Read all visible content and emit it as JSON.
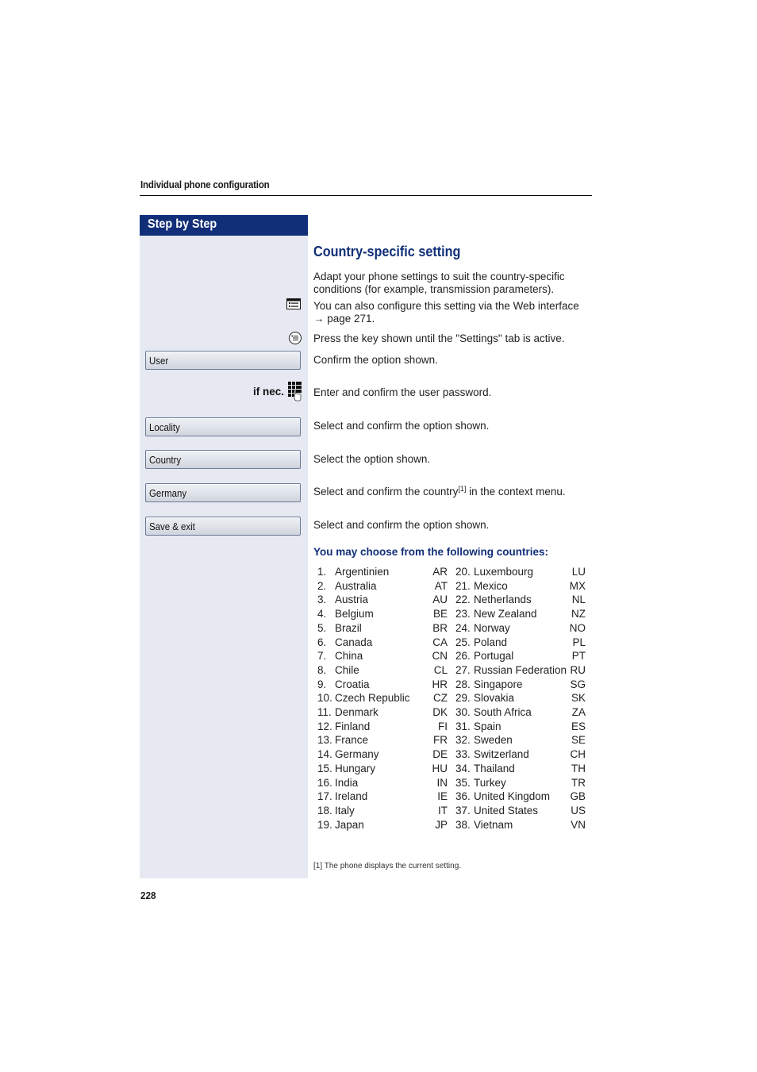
{
  "header": {
    "title": "Individual phone configuration"
  },
  "sidebar": {
    "title": "Step by Step"
  },
  "section": {
    "title": "Country-specific setting",
    "intro_line1": "Adapt your phone settings to suit the country-specific",
    "intro_line2": "conditions (for example, transmission parameters).",
    "web_line1": "You can also configure this setting via the Web interface",
    "web_line2": "→ page 271.",
    "press_key": "Press the key shown until the \"Settings\" tab is active."
  },
  "steps": [
    {
      "button": "User",
      "text": "Confirm the option shown."
    },
    {
      "label": "if nec.",
      "text": "Enter and confirm the user password."
    },
    {
      "button": "Locality",
      "text": "Select and confirm the option shown."
    },
    {
      "button": "Country",
      "text": "Select the option shown."
    },
    {
      "button": "Germany",
      "text_before": "Select and confirm the country",
      "footnote_ref": "[1]",
      "text_after": " in the context menu."
    },
    {
      "button": "Save & exit",
      "text": "Select and confirm the option shown."
    }
  ],
  "countries_heading": "You may choose from the following countries:",
  "countries": [
    {
      "num": "1.",
      "name": "Argentinien",
      "code": "AR"
    },
    {
      "num": "2.",
      "name": "Australia",
      "code": "AT"
    },
    {
      "num": "3.",
      "name": "Austria",
      "code": "AU"
    },
    {
      "num": "4.",
      "name": "Belgium",
      "code": "BE"
    },
    {
      "num": "5.",
      "name": "Brazil",
      "code": "BR"
    },
    {
      "num": "6.",
      "name": "Canada",
      "code": "CA"
    },
    {
      "num": "7.",
      "name": "China",
      "code": "CN"
    },
    {
      "num": "8.",
      "name": "Chile",
      "code": "CL"
    },
    {
      "num": "9.",
      "name": "Croatia",
      "code": "HR"
    },
    {
      "num": "10.",
      "name": "Czech Republic",
      "code": "CZ"
    },
    {
      "num": "11.",
      "name": "Denmark",
      "code": "DK"
    },
    {
      "num": "12.",
      "name": "Finland",
      "code": "FI"
    },
    {
      "num": "13.",
      "name": "France",
      "code": "FR"
    },
    {
      "num": "14.",
      "name": "Germany",
      "code": "DE"
    },
    {
      "num": "15.",
      "name": "Hungary",
      "code": "HU"
    },
    {
      "num": "16.",
      "name": "India",
      "code": "IN"
    },
    {
      "num": "17.",
      "name": "Ireland",
      "code": "IE"
    },
    {
      "num": "18.",
      "name": "Italy",
      "code": "IT"
    },
    {
      "num": "19.",
      "name": "Japan",
      "code": "JP"
    },
    {
      "num": "20.",
      "name": "Luxembourg",
      "code": "LU"
    },
    {
      "num": "21.",
      "name": "Mexico",
      "code": "MX"
    },
    {
      "num": "22.",
      "name": "Netherlands",
      "code": "NL"
    },
    {
      "num": "23.",
      "name": "New Zealand",
      "code": "NZ"
    },
    {
      "num": "24.",
      "name": "Norway",
      "code": "NO"
    },
    {
      "num": "25.",
      "name": "Poland",
      "code": "PL"
    },
    {
      "num": "26.",
      "name": "Portugal",
      "code": "PT"
    },
    {
      "num": "27.",
      "name": "Russian Federation",
      "code": "RU"
    },
    {
      "num": "28.",
      "name": "Singapore",
      "code": "SG"
    },
    {
      "num": "29.",
      "name": "Slovakia",
      "code": "SK"
    },
    {
      "num": "30.",
      "name": "South Africa",
      "code": "ZA"
    },
    {
      "num": "31.",
      "name": "Spain",
      "code": "ES"
    },
    {
      "num": "32.",
      "name": "Sweden",
      "code": "SE"
    },
    {
      "num": "33.",
      "name": "Switzerland",
      "code": "CH"
    },
    {
      "num": "34.",
      "name": "Thailand",
      "code": "TH"
    },
    {
      "num": "35.",
      "name": "Turkey",
      "code": "TR"
    },
    {
      "num": "36.",
      "name": "United Kingdom",
      "code": "GB"
    },
    {
      "num": "37.",
      "name": "United States",
      "code": "US"
    },
    {
      "num": "38.",
      "name": "Vietnam",
      "code": "VN"
    }
  ],
  "footnote": "[1]  The phone displays the current setting.",
  "page_number": "228",
  "icons": {
    "web_interface": "web-interface-icon",
    "menu_key": "menu-key-icon",
    "keypad": "keypad-icon"
  },
  "colors": {
    "accent": "#112f78",
    "sidebar_bg": "#e6e9f2"
  }
}
